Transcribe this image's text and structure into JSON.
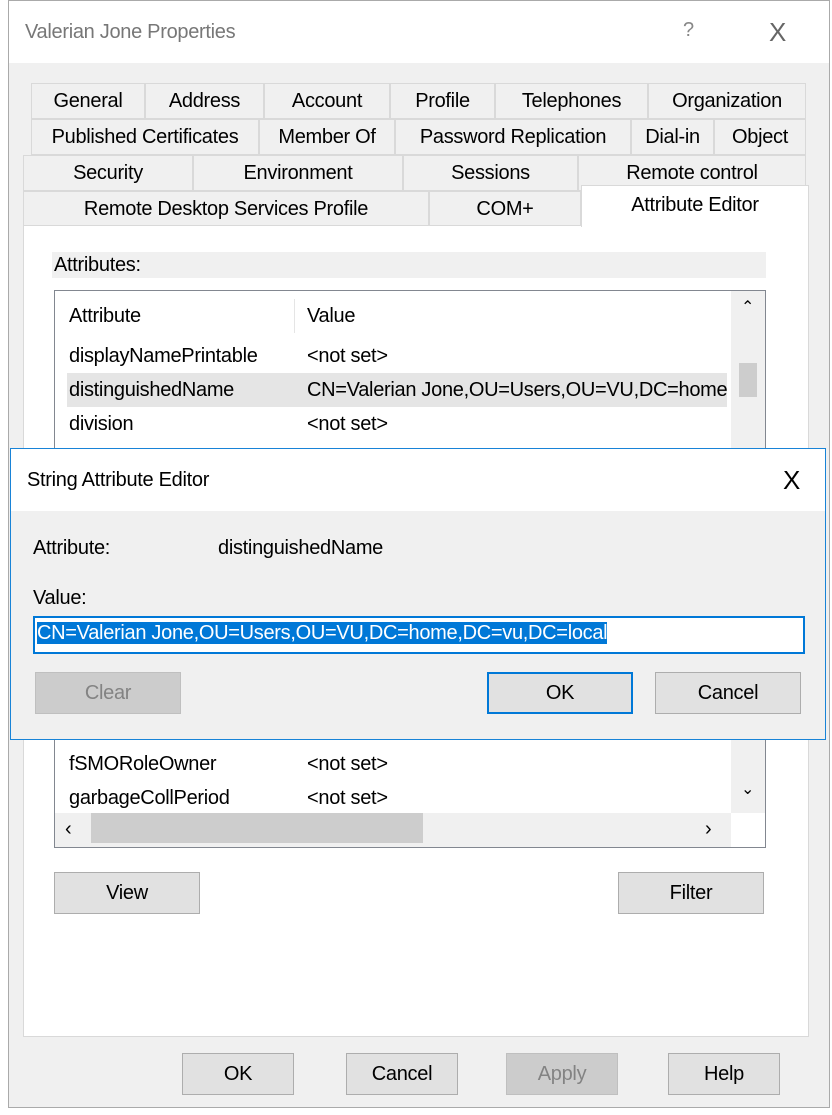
{
  "window": {
    "title": "Valerian Jone Properties",
    "help_label": "?",
    "close_label": "X"
  },
  "tabs": {
    "row1": [
      "General",
      "Address",
      "Account",
      "Profile",
      "Telephones",
      "Organization"
    ],
    "row2": [
      "Published Certificates",
      "Member Of",
      "Password Replication",
      "Dial-in",
      "Object"
    ],
    "row3": [
      "Security",
      "Environment",
      "Sessions",
      "Remote control"
    ],
    "row4": [
      "Remote Desktop Services Profile",
      "COM+",
      "Attribute Editor"
    ],
    "selected": "Attribute Editor"
  },
  "attributes": {
    "label": "Attributes:",
    "columns": [
      "Attribute",
      "Value"
    ],
    "rows": [
      {
        "name": "displayNamePrintable",
        "value": "<not set>"
      },
      {
        "name": "distinguishedName",
        "value": "CN=Valerian Jone,OU=Users,OU=VU,DC=home,DC=vu,DC=local"
      },
      {
        "name": "division",
        "value": "<not set>"
      },
      {
        "name": "fSMORoleOwner",
        "value": "<not set>"
      },
      {
        "name": "garbageCollPeriod",
        "value": "<not set>"
      }
    ],
    "view_label": "View",
    "filter_label": "Filter"
  },
  "footer": {
    "ok": "OK",
    "cancel": "Cancel",
    "apply": "Apply",
    "help": "Help"
  },
  "editor": {
    "title": "String Attribute Editor",
    "close_label": "X",
    "attribute_label": "Attribute:",
    "attribute_value": "distinguishedName",
    "value_label": "Value:",
    "value": "CN=Valerian Jone,OU=Users,OU=VU,DC=home,DC=vu,DC=local",
    "clear": "Clear",
    "ok": "OK",
    "cancel": "Cancel"
  },
  "colors": {
    "accent": "#0078d7",
    "selection": "#0078d7"
  }
}
